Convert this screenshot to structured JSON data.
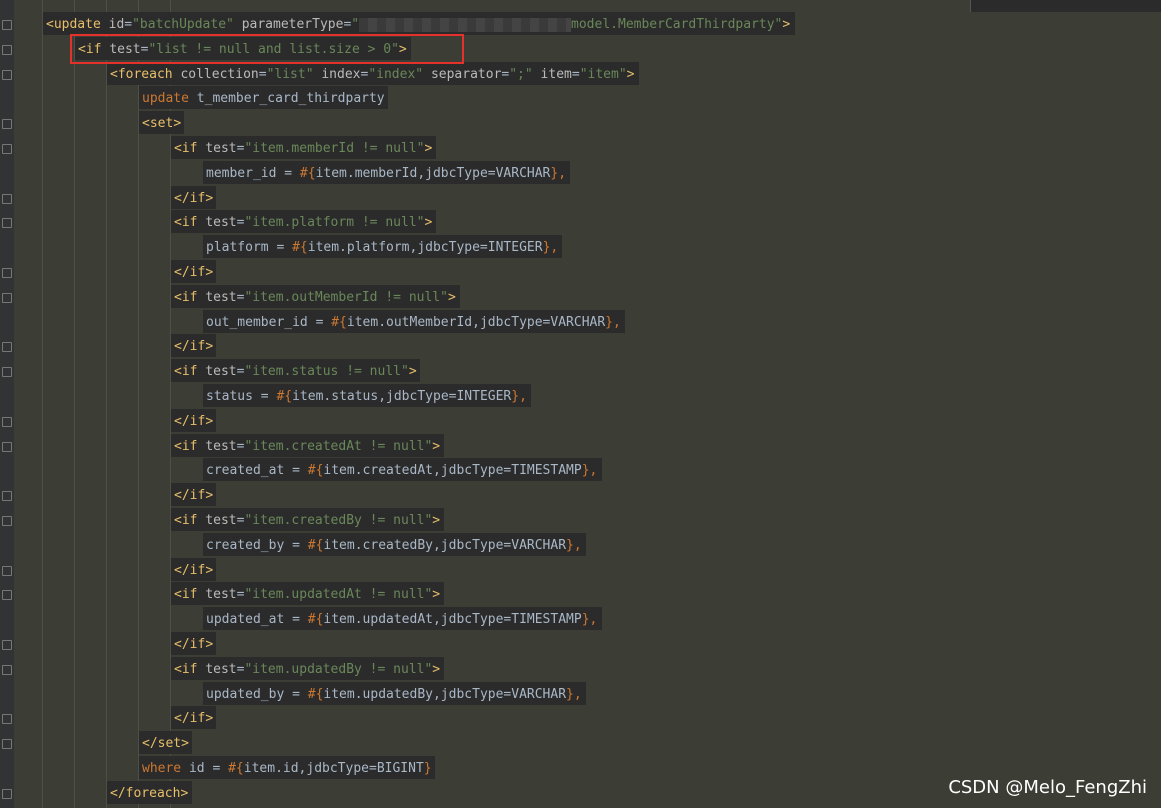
{
  "lines": [
    {
      "indent": 0,
      "fold": true,
      "tokens": [
        [
          "bracket",
          "<"
        ],
        [
          "tag",
          "update "
        ],
        [
          "attr",
          "id"
        ],
        [
          "sym",
          "="
        ],
        [
          "str",
          "\"batchUpdate\" "
        ],
        [
          "attr",
          "parameterType"
        ],
        [
          "sym",
          "="
        ],
        [
          "str",
          "\""
        ],
        [
          "redact",
          ""
        ],
        [
          "str",
          "model.MemberCardThirdparty\""
        ],
        [
          "bracket",
          ">"
        ]
      ]
    },
    {
      "indent": 1,
      "fold": true,
      "tokens": [
        [
          "bracket",
          "<"
        ],
        [
          "tag",
          "if "
        ],
        [
          "attr",
          "test"
        ],
        [
          "sym",
          "="
        ],
        [
          "str",
          "\"list != null and list.size > 0\""
        ],
        [
          "bracket",
          ">"
        ]
      ]
    },
    {
      "indent": 2,
      "fold": true,
      "tokens": [
        [
          "bracket",
          "<"
        ],
        [
          "tag",
          "foreach "
        ],
        [
          "attr",
          "collection"
        ],
        [
          "sym",
          "="
        ],
        [
          "str",
          "\"list\" "
        ],
        [
          "attr",
          "index"
        ],
        [
          "sym",
          "="
        ],
        [
          "str",
          "\"index\" "
        ],
        [
          "attr",
          "separator"
        ],
        [
          "sym",
          "="
        ],
        [
          "str",
          "\";\" "
        ],
        [
          "attr",
          "item"
        ],
        [
          "sym",
          "="
        ],
        [
          "str",
          "\"item\""
        ],
        [
          "bracket",
          ">"
        ]
      ]
    },
    {
      "indent": 3,
      "fold": false,
      "tokens": [
        [
          "sql",
          "update "
        ],
        [
          "sym",
          "t_member_card_thirdparty"
        ]
      ]
    },
    {
      "indent": 3,
      "fold": true,
      "tokens": [
        [
          "bracket",
          "<"
        ],
        [
          "tag",
          "set"
        ],
        [
          "bracket",
          ">"
        ]
      ]
    },
    {
      "indent": 4,
      "fold": true,
      "tokens": [
        [
          "bracket",
          "<"
        ],
        [
          "tag",
          "if "
        ],
        [
          "attr",
          "test"
        ],
        [
          "sym",
          "="
        ],
        [
          "str",
          "\"item.memberId != null\""
        ],
        [
          "bracket",
          ">"
        ]
      ]
    },
    {
      "indent": 5,
      "fold": false,
      "tokens": [
        [
          "sym",
          "member_id = "
        ],
        [
          "hash",
          "#{"
        ],
        [
          "sym",
          "item.memberId,jdbcType=VARCHAR"
        ],
        [
          "hash",
          "}"
        ],
        [
          "punct",
          ","
        ]
      ]
    },
    {
      "indent": 4,
      "fold": true,
      "tokens": [
        [
          "bracket",
          "</"
        ],
        [
          "tag",
          "if"
        ],
        [
          "bracket",
          ">"
        ]
      ]
    },
    {
      "indent": 4,
      "fold": true,
      "tokens": [
        [
          "bracket",
          "<"
        ],
        [
          "tag",
          "if "
        ],
        [
          "attr",
          "test"
        ],
        [
          "sym",
          "="
        ],
        [
          "str",
          "\"item.platform != null\""
        ],
        [
          "bracket",
          ">"
        ]
      ]
    },
    {
      "indent": 5,
      "fold": false,
      "tokens": [
        [
          "sym",
          "platform = "
        ],
        [
          "hash",
          "#{"
        ],
        [
          "sym",
          "item.platform,jdbcType=INTEGER"
        ],
        [
          "hash",
          "}"
        ],
        [
          "punct",
          ","
        ]
      ]
    },
    {
      "indent": 4,
      "fold": true,
      "tokens": [
        [
          "bracket",
          "</"
        ],
        [
          "tag",
          "if"
        ],
        [
          "bracket",
          ">"
        ]
      ]
    },
    {
      "indent": 4,
      "fold": true,
      "tokens": [
        [
          "bracket",
          "<"
        ],
        [
          "tag",
          "if "
        ],
        [
          "attr",
          "test"
        ],
        [
          "sym",
          "="
        ],
        [
          "str",
          "\"item.outMemberId != null\""
        ],
        [
          "bracket",
          ">"
        ]
      ]
    },
    {
      "indent": 5,
      "fold": false,
      "tokens": [
        [
          "sym",
          "out_member_id = "
        ],
        [
          "hash",
          "#{"
        ],
        [
          "sym",
          "item.outMemberId,jdbcType=VARCHAR"
        ],
        [
          "hash",
          "}"
        ],
        [
          "punct",
          ","
        ]
      ]
    },
    {
      "indent": 4,
      "fold": true,
      "tokens": [
        [
          "bracket",
          "</"
        ],
        [
          "tag",
          "if"
        ],
        [
          "bracket",
          ">"
        ]
      ]
    },
    {
      "indent": 4,
      "fold": true,
      "tokens": [
        [
          "bracket",
          "<"
        ],
        [
          "tag",
          "if "
        ],
        [
          "attr",
          "test"
        ],
        [
          "sym",
          "="
        ],
        [
          "str",
          "\"item.status != null\""
        ],
        [
          "bracket",
          ">"
        ]
      ]
    },
    {
      "indent": 5,
      "fold": false,
      "tokens": [
        [
          "sym",
          "status = "
        ],
        [
          "hash",
          "#{"
        ],
        [
          "sym",
          "item.status,jdbcType=INTEGER"
        ],
        [
          "hash",
          "}"
        ],
        [
          "punct",
          ","
        ]
      ]
    },
    {
      "indent": 4,
      "fold": true,
      "tokens": [
        [
          "bracket",
          "</"
        ],
        [
          "tag",
          "if"
        ],
        [
          "bracket",
          ">"
        ]
      ]
    },
    {
      "indent": 4,
      "fold": true,
      "tokens": [
        [
          "bracket",
          "<"
        ],
        [
          "tag",
          "if "
        ],
        [
          "attr",
          "test"
        ],
        [
          "sym",
          "="
        ],
        [
          "str",
          "\"item.createdAt != null\""
        ],
        [
          "bracket",
          ">"
        ]
      ]
    },
    {
      "indent": 5,
      "fold": false,
      "tokens": [
        [
          "sym",
          "created_at = "
        ],
        [
          "hash",
          "#{"
        ],
        [
          "sym",
          "item.createdAt,jdbcType=TIMESTAMP"
        ],
        [
          "hash",
          "}"
        ],
        [
          "punct",
          ","
        ]
      ]
    },
    {
      "indent": 4,
      "fold": true,
      "tokens": [
        [
          "bracket",
          "</"
        ],
        [
          "tag",
          "if"
        ],
        [
          "bracket",
          ">"
        ]
      ]
    },
    {
      "indent": 4,
      "fold": true,
      "tokens": [
        [
          "bracket",
          "<"
        ],
        [
          "tag",
          "if "
        ],
        [
          "attr",
          "test"
        ],
        [
          "sym",
          "="
        ],
        [
          "str",
          "\"item.createdBy != null\""
        ],
        [
          "bracket",
          ">"
        ]
      ]
    },
    {
      "indent": 5,
      "fold": false,
      "tokens": [
        [
          "sym",
          "created_by = "
        ],
        [
          "hash",
          "#{"
        ],
        [
          "sym",
          "item.createdBy,jdbcType=VARCHAR"
        ],
        [
          "hash",
          "}"
        ],
        [
          "punct",
          ","
        ]
      ]
    },
    {
      "indent": 4,
      "fold": true,
      "tokens": [
        [
          "bracket",
          "</"
        ],
        [
          "tag",
          "if"
        ],
        [
          "bracket",
          ">"
        ]
      ]
    },
    {
      "indent": 4,
      "fold": true,
      "tokens": [
        [
          "bracket",
          "<"
        ],
        [
          "tag",
          "if "
        ],
        [
          "attr",
          "test"
        ],
        [
          "sym",
          "="
        ],
        [
          "str",
          "\"item.updatedAt != null\""
        ],
        [
          "bracket",
          ">"
        ]
      ]
    },
    {
      "indent": 5,
      "fold": false,
      "tokens": [
        [
          "sym",
          "updated_at = "
        ],
        [
          "hash",
          "#{"
        ],
        [
          "sym",
          "item.updatedAt,jdbcType=TIMESTAMP"
        ],
        [
          "hash",
          "}"
        ],
        [
          "punct",
          ","
        ]
      ]
    },
    {
      "indent": 4,
      "fold": true,
      "tokens": [
        [
          "bracket",
          "</"
        ],
        [
          "tag",
          "if"
        ],
        [
          "bracket",
          ">"
        ]
      ]
    },
    {
      "indent": 4,
      "fold": true,
      "tokens": [
        [
          "bracket",
          "<"
        ],
        [
          "tag",
          "if "
        ],
        [
          "attr",
          "test"
        ],
        [
          "sym",
          "="
        ],
        [
          "str",
          "\"item.updatedBy != null\""
        ],
        [
          "bracket",
          ">"
        ]
      ]
    },
    {
      "indent": 5,
      "fold": false,
      "tokens": [
        [
          "sym",
          "updated_by = "
        ],
        [
          "hash",
          "#{"
        ],
        [
          "sym",
          "item.updatedBy,jdbcType=VARCHAR"
        ],
        [
          "hash",
          "}"
        ],
        [
          "punct",
          ","
        ]
      ]
    },
    {
      "indent": 4,
      "fold": true,
      "tokens": [
        [
          "bracket",
          "</"
        ],
        [
          "tag",
          "if"
        ],
        [
          "bracket",
          ">"
        ]
      ]
    },
    {
      "indent": 3,
      "fold": true,
      "tokens": [
        [
          "bracket",
          "</"
        ],
        [
          "tag",
          "set"
        ],
        [
          "bracket",
          ">"
        ]
      ]
    },
    {
      "indent": 3,
      "fold": false,
      "tokens": [
        [
          "sql",
          "where "
        ],
        [
          "sym",
          "id = "
        ],
        [
          "hash",
          "#{"
        ],
        [
          "sym",
          "item.id,jdbcType=BIGINT"
        ],
        [
          "hash",
          "}"
        ]
      ]
    },
    {
      "indent": 2,
      "fold": true,
      "tokens": [
        [
          "bracket",
          "</"
        ],
        [
          "tag",
          "foreach"
        ],
        [
          "bracket",
          ">"
        ]
      ]
    }
  ],
  "watermark": "CSDN @Melo_FengZhi",
  "colors": {
    "editor_bg": "#3c3d34",
    "code_bg": "#2b2b2b",
    "tag": "#e8bf6a",
    "string": "#6a8759",
    "keyword": "#cc7832",
    "text": "#a9b7c6",
    "highlight_box": "#e5312b"
  }
}
